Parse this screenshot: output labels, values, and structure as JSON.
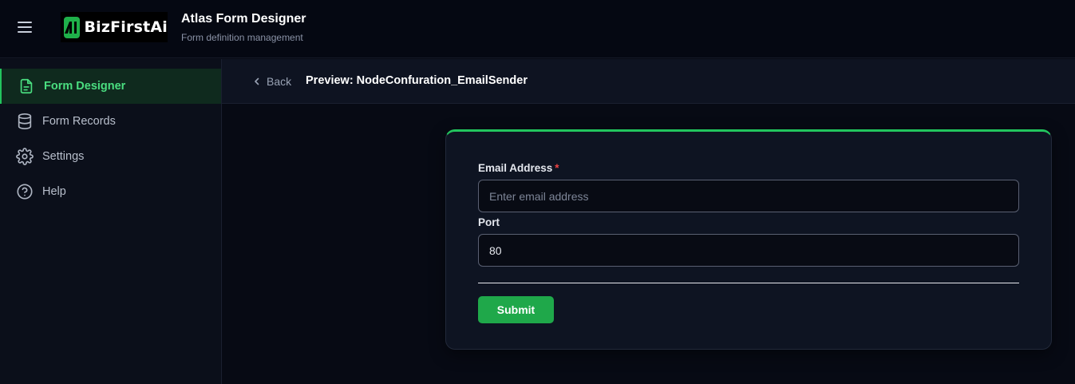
{
  "header": {
    "menu_icon": "hamburger-menu-icon",
    "logo_text": "BizFirstAi",
    "title": "Atlas Form Designer",
    "subtitle": "Form definition management"
  },
  "sidebar": {
    "items": [
      {
        "label": "Form Designer",
        "icon": "file-text-icon",
        "active": true
      },
      {
        "label": "Form Records",
        "icon": "database-icon",
        "active": false
      },
      {
        "label": "Settings",
        "icon": "gear-icon",
        "active": false
      },
      {
        "label": "Help",
        "icon": "help-circle-icon",
        "active": false
      }
    ]
  },
  "toolbar": {
    "back_label": "Back",
    "preview_title": "Preview: NodeConfuration_EmailSender"
  },
  "form": {
    "fields": [
      {
        "label": "Email Address",
        "required_mark": "*",
        "placeholder": "Enter email address",
        "value": ""
      },
      {
        "label": "Port",
        "placeholder": "",
        "value": "80"
      }
    ],
    "submit_label": "Submit"
  },
  "colors": {
    "accent": "#22c55e",
    "background": "#070a14",
    "required": "#ef4444"
  }
}
